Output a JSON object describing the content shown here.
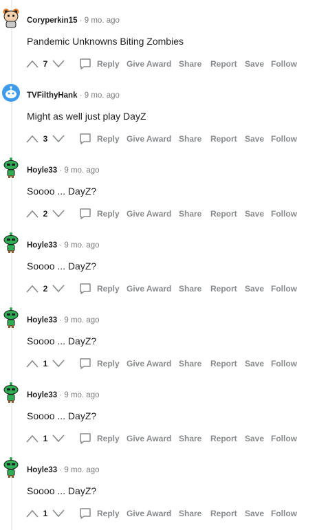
{
  "comments": [
    {
      "username": "Coryperkin15",
      "separator": "·",
      "time": "9 mo. ago",
      "text": "Pandemic Unknowns Biting Zombies",
      "score": "7",
      "avatar": "orange-snoo-avatar-icon"
    },
    {
      "username": "TVFilthyHank",
      "separator": "·",
      "time": "9 mo. ago",
      "text": "Might as well just play DayZ",
      "score": "3",
      "avatar": "blue-snoo-avatar-icon"
    },
    {
      "username": "Hoyle33",
      "separator": "·",
      "time": "9 mo. ago",
      "text": "Soooo ... DayZ?",
      "score": "2",
      "avatar": "green-snoo-avatar-icon"
    },
    {
      "username": "Hoyle33",
      "separator": "·",
      "time": "9 mo. ago",
      "text": "Soooo ... DayZ?",
      "score": "2",
      "avatar": "green-snoo-avatar-icon"
    },
    {
      "username": "Hoyle33",
      "separator": "·",
      "time": "9 mo. ago",
      "text": "Soooo ... DayZ?",
      "score": "1",
      "avatar": "green-snoo-avatar-icon"
    },
    {
      "username": "Hoyle33",
      "separator": "·",
      "time": "9 mo. ago",
      "text": "Soooo ... DayZ?",
      "score": "1",
      "avatar": "green-snoo-avatar-icon"
    },
    {
      "username": "Hoyle33",
      "separator": "·",
      "time": "9 mo. ago",
      "text": "Soooo ... DayZ?",
      "score": "1",
      "avatar": "green-snoo-avatar-icon"
    }
  ],
  "actions": {
    "reply": "Reply",
    "give_award": "Give Award",
    "share": "Share",
    "report": "Report",
    "save": "Save",
    "follow": "Follow"
  },
  "colors": {
    "action_text": "#878a8c",
    "meta_text": "#7c7c7c",
    "thread_line": "#edeff1",
    "orange_avatar": "#e07a2e",
    "blue_avatar": "#3d9be9",
    "green_avatar": "#2fae55"
  }
}
